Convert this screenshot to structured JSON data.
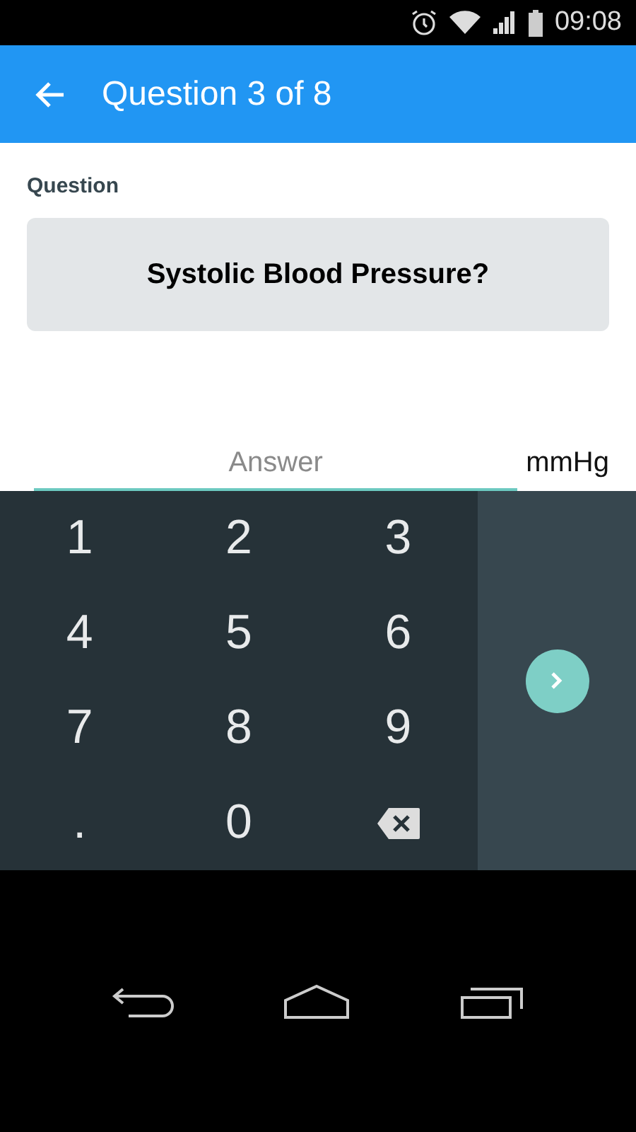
{
  "status_bar": {
    "time": "09:08"
  },
  "app_bar": {
    "title": "Question 3 of 8"
  },
  "question": {
    "label": "Question",
    "text": "Systolic Blood Pressure?"
  },
  "answer": {
    "placeholder": "Answer",
    "unit": "mmHg"
  },
  "keypad": {
    "keys": [
      {
        "kind": "char",
        "label": "1"
      },
      {
        "kind": "char",
        "label": "2"
      },
      {
        "kind": "char",
        "label": "3"
      },
      {
        "kind": "char",
        "label": "4"
      },
      {
        "kind": "char",
        "label": "5"
      },
      {
        "kind": "char",
        "label": "6"
      },
      {
        "kind": "char",
        "label": "7"
      },
      {
        "kind": "char",
        "label": "8"
      },
      {
        "kind": "char",
        "label": "9"
      },
      {
        "kind": "char",
        "label": "."
      },
      {
        "kind": "char",
        "label": "0"
      },
      {
        "kind": "backspace"
      }
    ]
  }
}
